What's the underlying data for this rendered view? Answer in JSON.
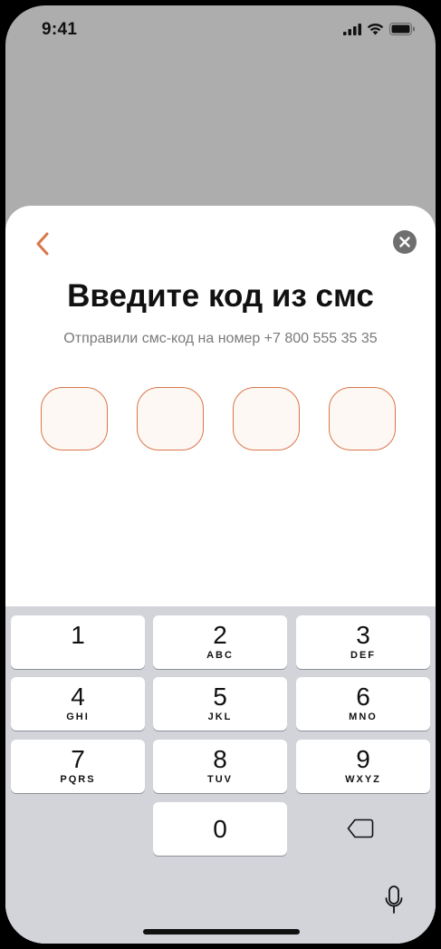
{
  "status_bar": {
    "time": "9:41",
    "icons": [
      "signal-icon",
      "wifi-icon",
      "battery-icon"
    ]
  },
  "sheet": {
    "back_icon": "chevron-left-icon",
    "close_icon": "close-circle-icon",
    "title": "Введите код из смс",
    "subtitle": "Отправили смс-код на номер +7 800 555 35 35",
    "code_cells": [
      "",
      "",
      "",
      ""
    ],
    "accent_color": "#d9774a"
  },
  "keyboard": {
    "keys": [
      {
        "digit": "1",
        "letters": ""
      },
      {
        "digit": "2",
        "letters": "ABC"
      },
      {
        "digit": "3",
        "letters": "DEF"
      },
      {
        "digit": "4",
        "letters": "GHI"
      },
      {
        "digit": "5",
        "letters": "JKL"
      },
      {
        "digit": "6",
        "letters": "MNO"
      },
      {
        "digit": "7",
        "letters": "PQRS"
      },
      {
        "digit": "8",
        "letters": "TUV"
      },
      {
        "digit": "9",
        "letters": "WXYZ"
      },
      {
        "digit": "0",
        "letters": ""
      }
    ],
    "delete_icon": "backspace-icon",
    "mic_icon": "microphone-icon"
  }
}
